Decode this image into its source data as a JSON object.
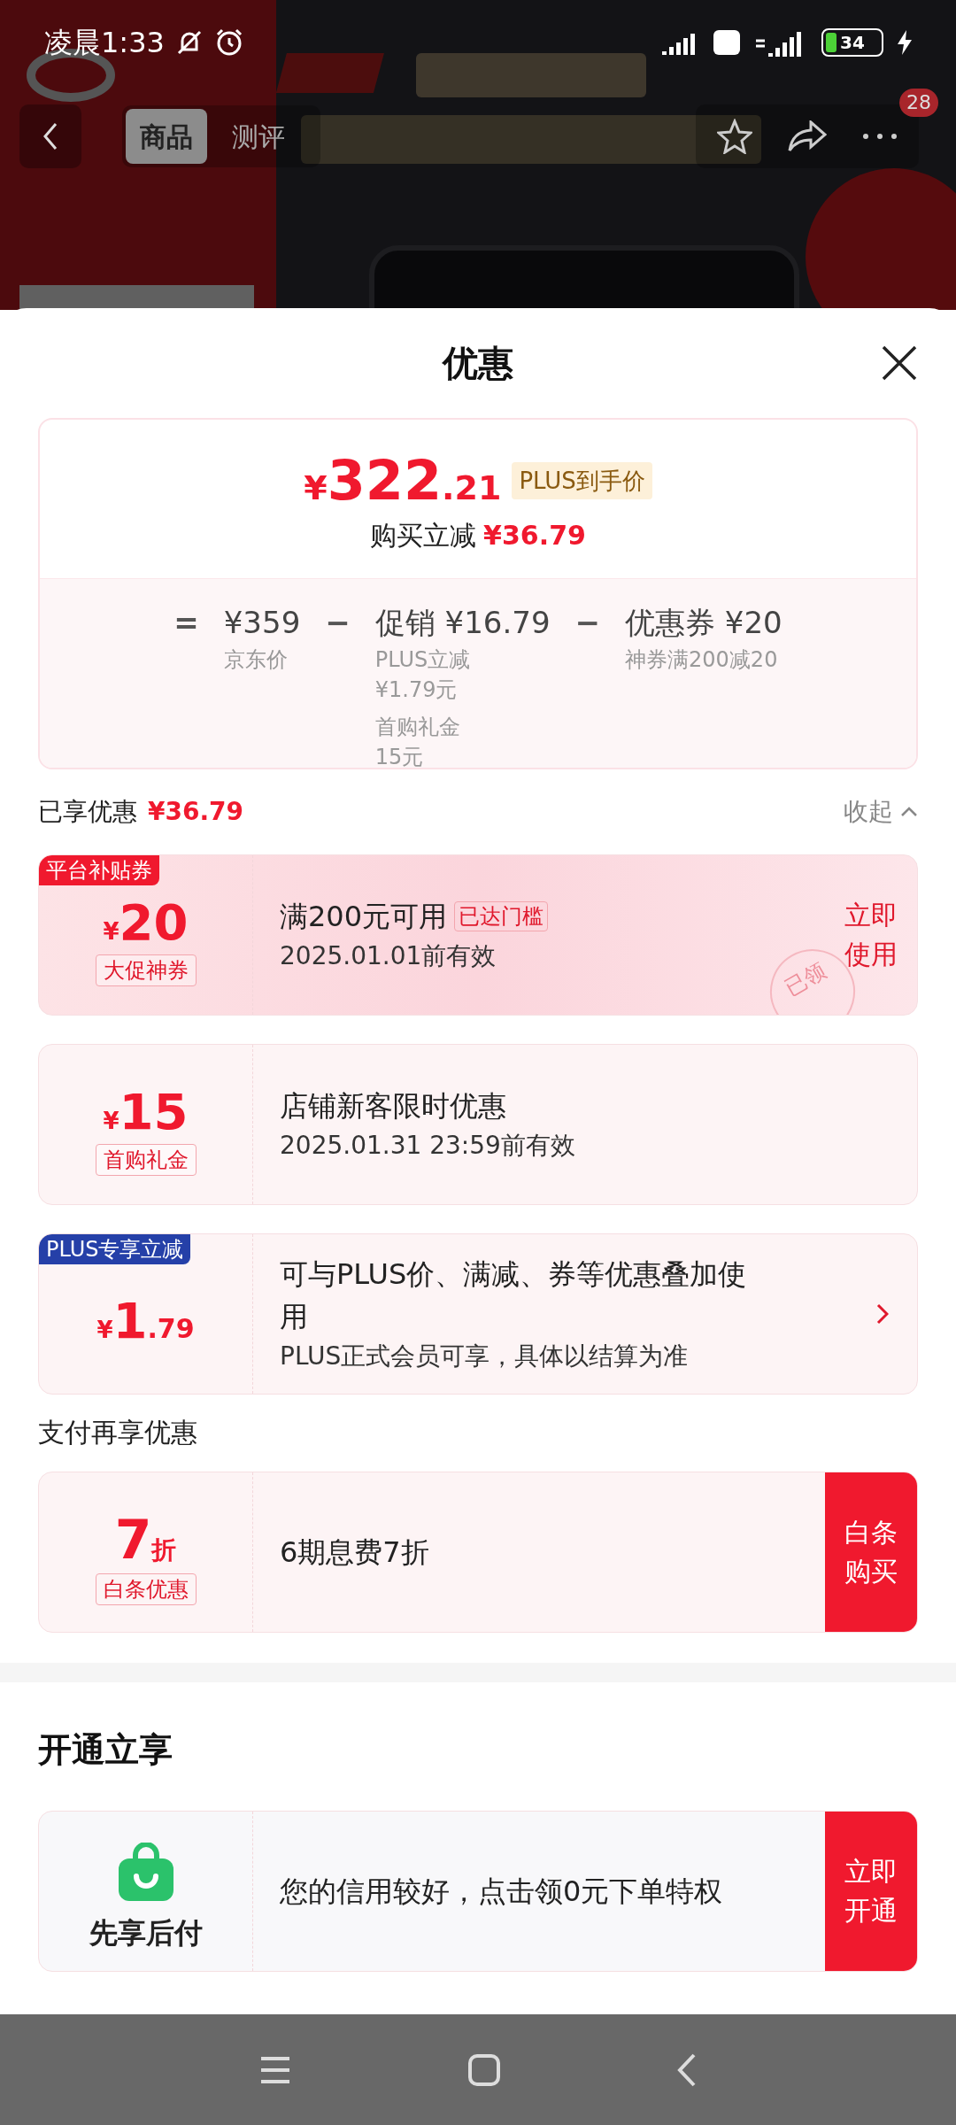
{
  "status_bar": {
    "time": "凌晨1:33",
    "battery": "34"
  },
  "top_nav": {
    "tabs": [
      {
        "label": "商品",
        "selected": true
      },
      {
        "label": "测评",
        "selected": false
      }
    ],
    "badge": "28"
  },
  "sheet": {
    "title": "优惠"
  },
  "price_card": {
    "currency": "¥",
    "price_int": "322",
    "price_dec": ".21",
    "price_tag": "PLUS到手价",
    "saving_label": "购买立减",
    "saving_amount": "¥36.79",
    "breakdown": [
      {
        "operator": "=",
        "amount": "¥359",
        "notes": [
          [
            "京东价"
          ]
        ]
      },
      {
        "operator": "−",
        "amount": "促销 ¥16.79",
        "notes": [
          [
            "PLUS立减",
            "¥1.79元"
          ],
          [
            "首购礼金",
            "15元"
          ]
        ]
      },
      {
        "operator": "−",
        "amount": "优惠券 ¥20",
        "notes": [
          [
            "神券满200减20"
          ]
        ]
      }
    ]
  },
  "enjoyed": {
    "label": "已享优惠",
    "amount": "¥36.79",
    "toggle": "收起",
    "expanded": true
  },
  "coupons": [
    {
      "kind": "coupon",
      "highlighted": true,
      "corner_tag": "平台补贴券",
      "color": "#f0192e",
      "currency": "¥",
      "amount": "20",
      "badge": "大促神券",
      "title": "满200元可用",
      "title_tag": "已达门槛",
      "subtitle": "2025.01.01前有效",
      "stamp": "已领",
      "action": {
        "lines": [
          "立即",
          "使用"
        ],
        "filled": false
      }
    },
    {
      "kind": "coupon",
      "highlighted": false,
      "currency": "¥",
      "amount": "15",
      "badge": "首购礼金",
      "title": "店铺新客限时优惠",
      "subtitle": "2025.01.31 23:59前有效"
    },
    {
      "kind": "coupon",
      "highlighted": false,
      "corner_tag": "PLUS专享立减",
      "color": "#2540a8",
      "currency": "¥",
      "amount": "1",
      "amount_dec": ".79",
      "title": "可与PLUS价、满减、券等优惠叠加使用",
      "subtitle": "PLUS正式会员可享，具体以结算为准",
      "chevron": true
    }
  ],
  "pay_section": {
    "title": "支付再享优惠",
    "cards": [
      {
        "kind": "discount",
        "amount": "7",
        "unit": "折",
        "badge": "白条优惠",
        "title": "6期息费7折",
        "action": {
          "lines": [
            "白条",
            "购买"
          ],
          "filled": true
        }
      }
    ]
  },
  "open_section": {
    "title": "开通立享",
    "cards": [
      {
        "kind": "service",
        "label": "先享后付",
        "title": "您的信用较好，点击领0元下单特权",
        "action": {
          "lines": [
            "立即",
            "开通"
          ],
          "filled": true
        }
      }
    ]
  }
}
